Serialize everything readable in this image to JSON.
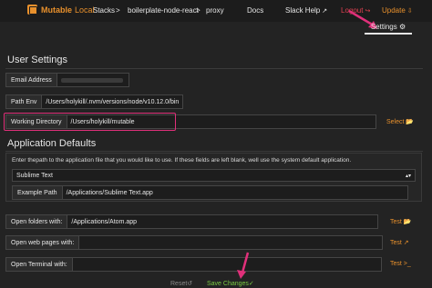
{
  "topbar": {
    "brand_bold": "Mutable",
    "brand_rest": "Local",
    "stacks": "Stacks",
    "sep1": ">",
    "stack_name": "boilerplate-node-react",
    "sep2": ">",
    "service": "proxy",
    "docs": "Docs",
    "slack": "Slack Help",
    "logout": "Logout",
    "update": "Update"
  },
  "settings_tab": {
    "label": "Settings",
    "icon": "gear-icon"
  },
  "user_settings": {
    "heading": "User Settings",
    "email_label": "Email Address",
    "path_env_label": "Path Env",
    "path_env_value": "/Users/holykill/.nvm/versions/node/v10.12.0/bin",
    "workdir_label": "Working Directory",
    "workdir_value": "/Users/holykill/mutable",
    "select_label": "Select"
  },
  "app_defaults": {
    "heading": "Application Defaults",
    "hint": "Enter thepath to the application file that you would like to use. If these fields are left blank, well use the system default application.",
    "editor_selected": "Sublime Text",
    "example_label": "Example Path",
    "example_value": "/Applications/Sublime Text.app",
    "folders_label": "Open folders with:",
    "folders_value": "/Applications/Atom.app",
    "web_label": "Open web pages with:",
    "web_value": "",
    "terminal_label": "Open Terminal with:",
    "terminal_value": "",
    "test_label": "Test"
  },
  "footer": {
    "reset": "Reset",
    "save": "Save Changes"
  },
  "colors": {
    "accent": "#e8902c",
    "highlight": "#e0307a",
    "logout": "#e04050",
    "save": "#7ac943"
  }
}
